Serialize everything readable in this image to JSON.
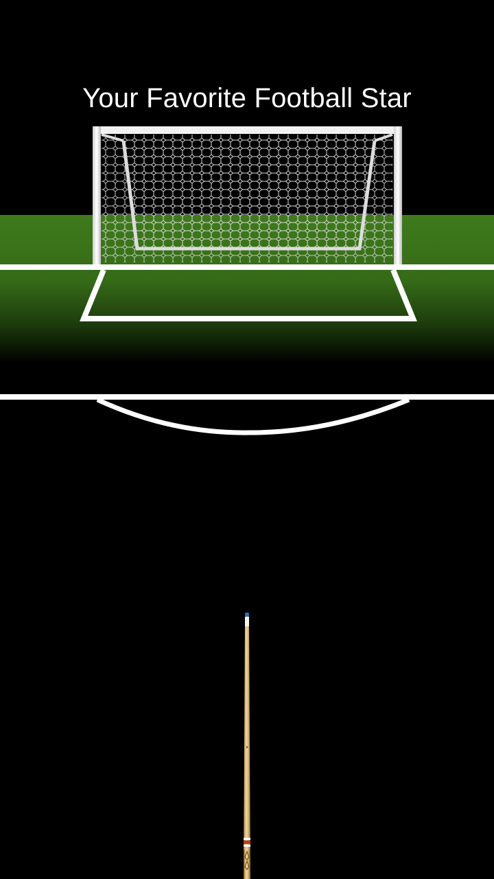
{
  "title": "Your Favorite Football Star",
  "colors": {
    "background": "#000000",
    "grass": "#3f7a1c",
    "lines": "#ffffff",
    "goal_frame": "#f2f2f2",
    "cue_wood": "#e8c88a"
  },
  "icons": {
    "goal": "soccer-goal-icon",
    "cue": "billiard-cue-icon"
  }
}
